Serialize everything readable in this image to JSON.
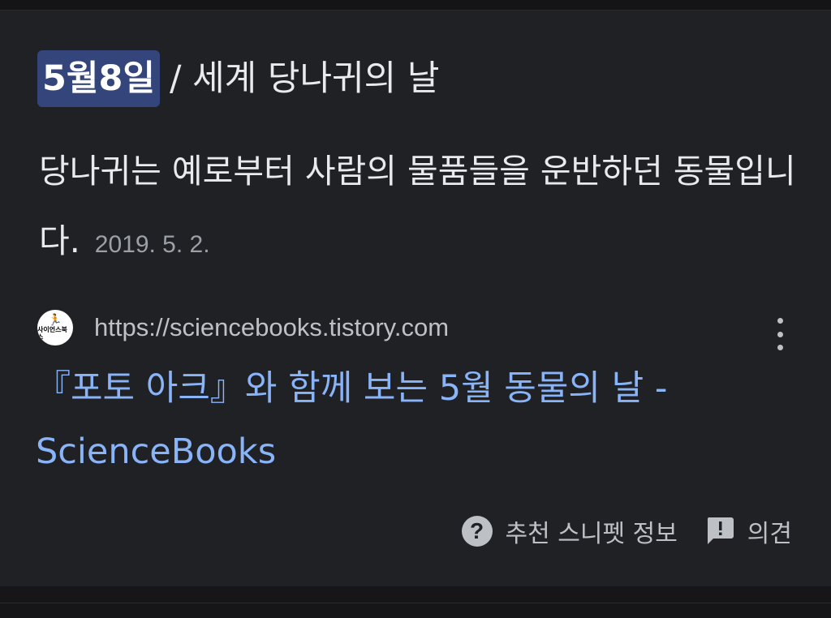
{
  "heading": {
    "highlight": "5월8일",
    "rest": "/ 세계 당나귀의 날"
  },
  "snippet": {
    "text": "당나귀는 예로부터 사람의 물품들을 운반하던 동물입니다.",
    "date": "2019. 5. 2."
  },
  "source": {
    "favicon_label": "사이언스북스",
    "url": "https://sciencebooks.tistory.com"
  },
  "result": {
    "title": "『포토 아크』와 함께 보는 5월 동물의 날 - ScienceBooks"
  },
  "footer": {
    "about_label": "추천 스니펫 정보",
    "feedback_label": "의견"
  },
  "icons": {
    "help": "help-circle-icon",
    "feedback": "feedback-icon",
    "more": "more-vert-icon"
  },
  "colors": {
    "background": "#202124",
    "highlight": "#33457a",
    "link": "#8ab4f8",
    "text": "#e8eaed",
    "muted": "#9aa0a6"
  }
}
